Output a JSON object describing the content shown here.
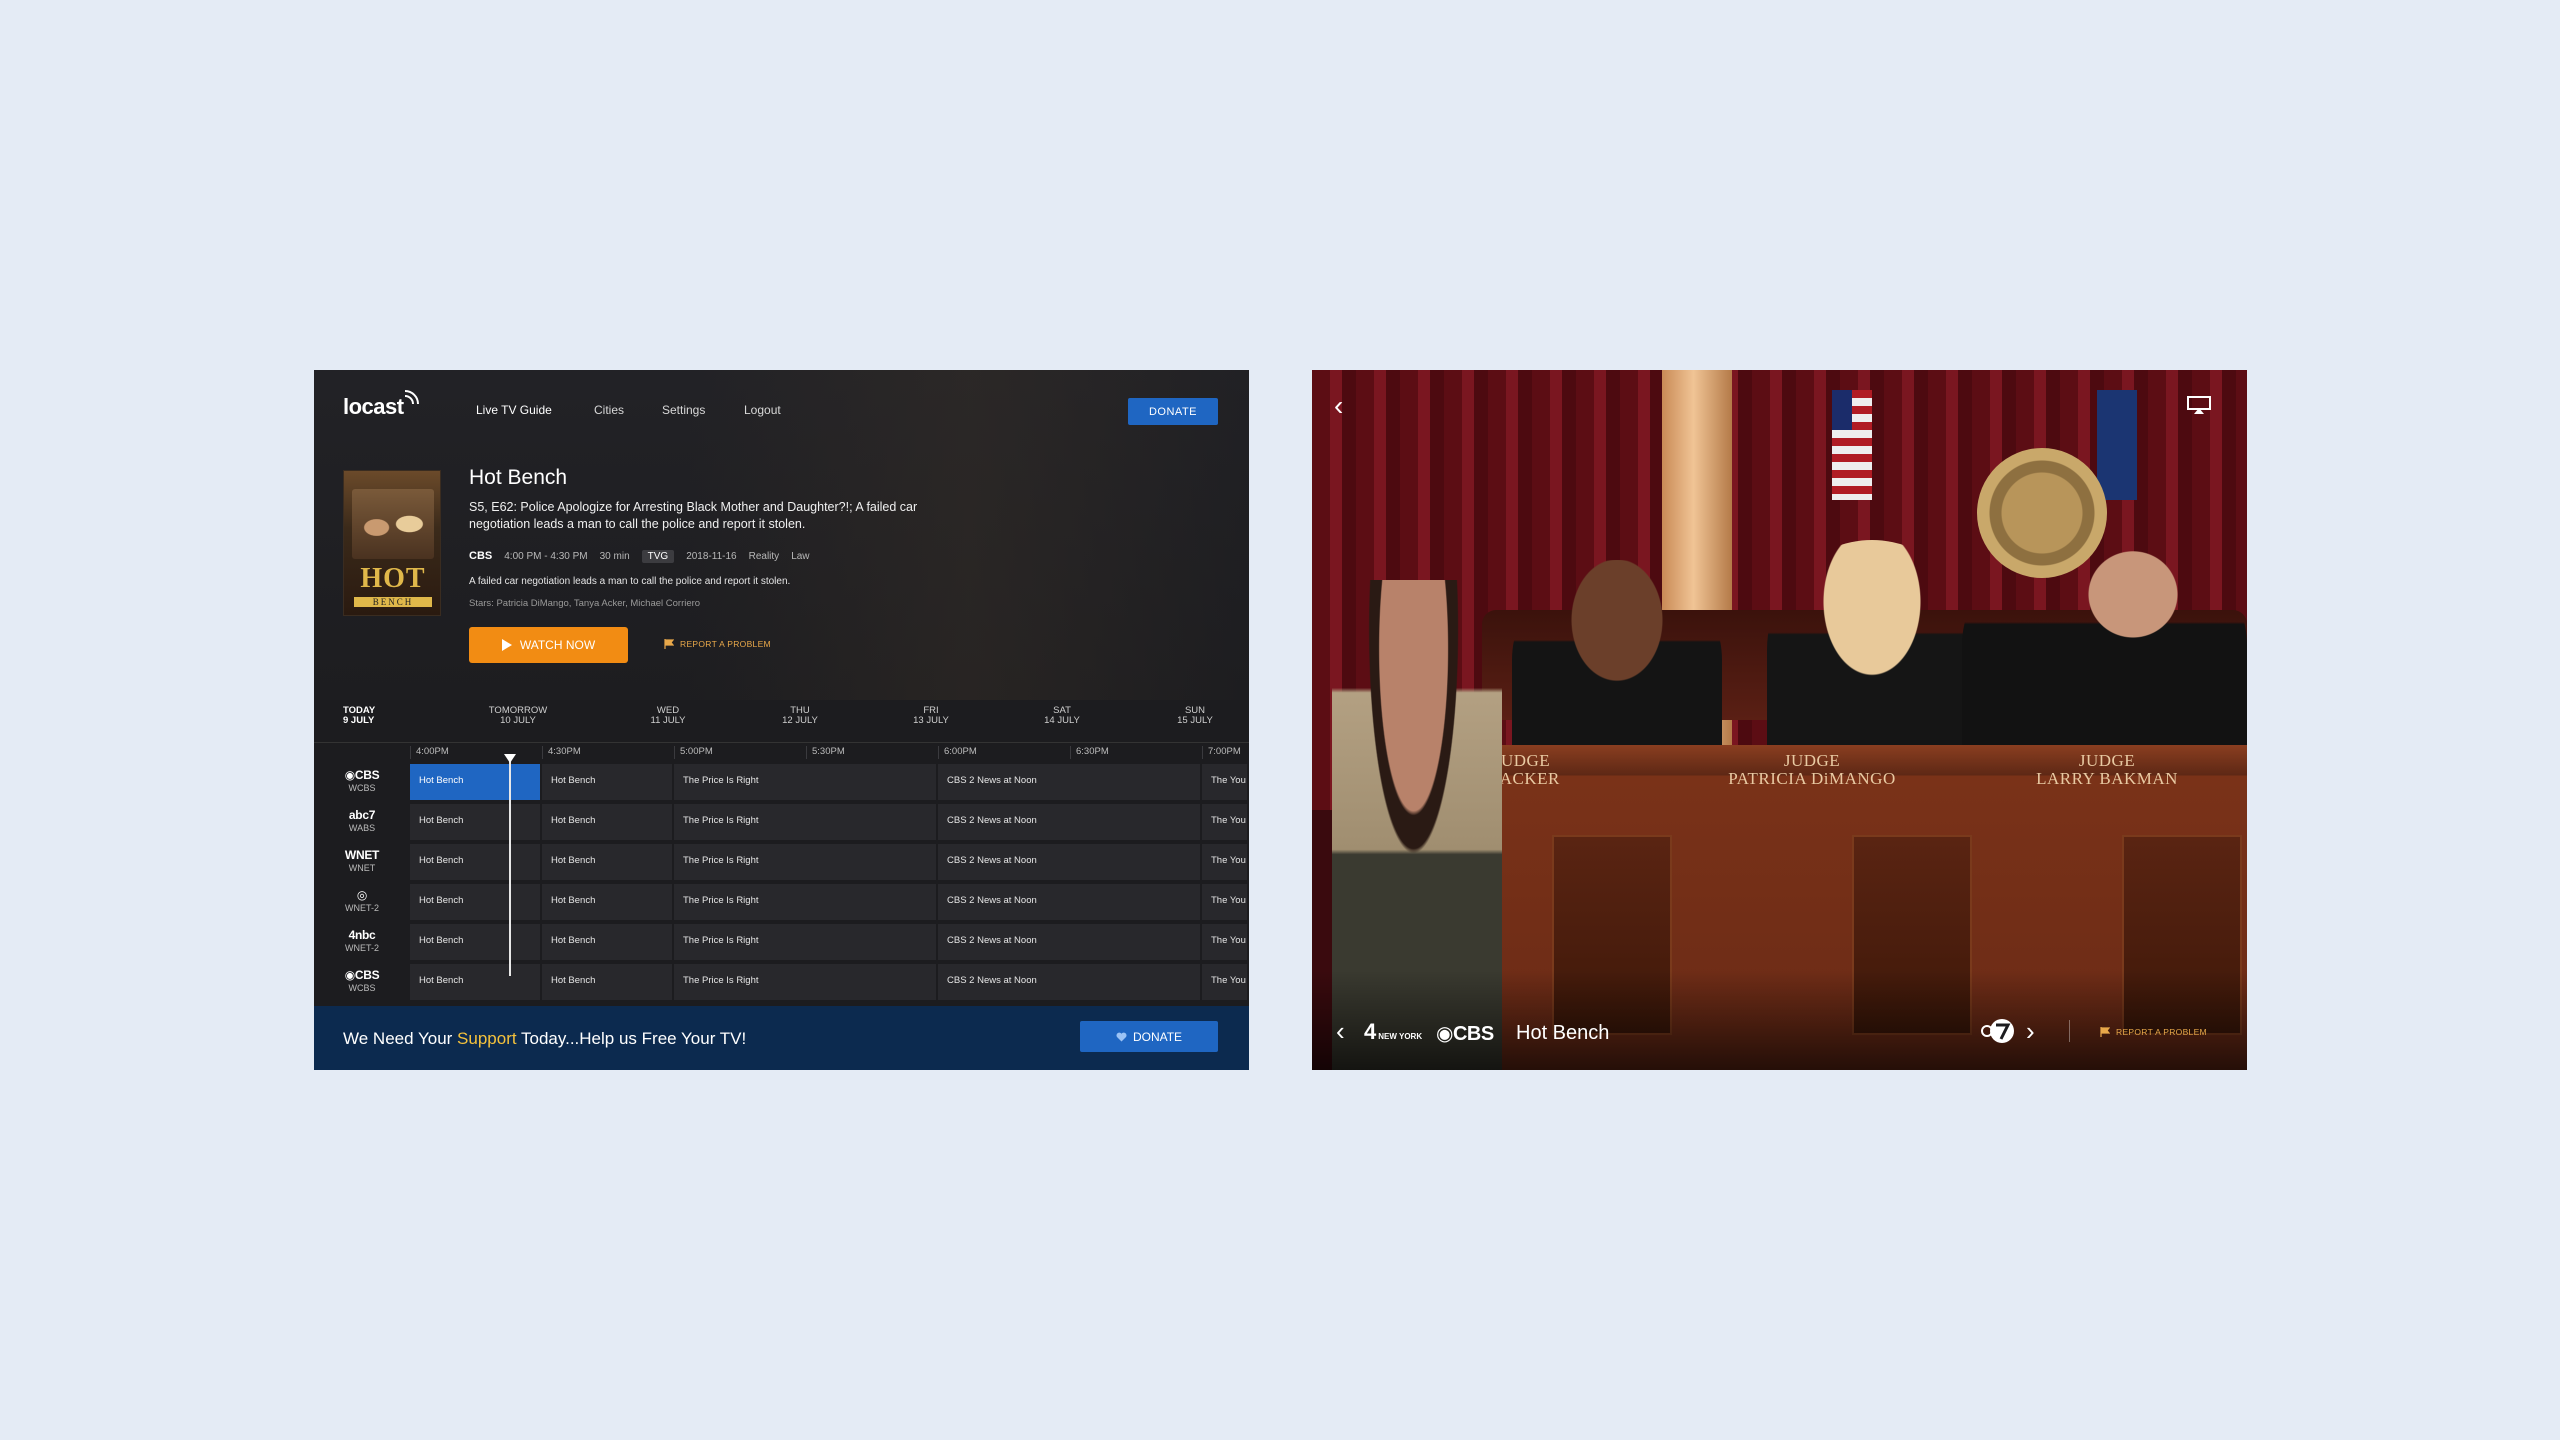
{
  "guide": {
    "logo": "locast",
    "nav": [
      "Live TV Guide",
      "Cities",
      "Settings",
      "Logout"
    ],
    "donate_top": "DONATE",
    "show": {
      "title": "Hot Bench",
      "poster_title": "HOT",
      "poster_subtitle": "BENCH",
      "episode": "S5, E62: Police Apologize for Arresting Black Mother and Daughter?!; A failed car negotiation leads a man to call the police and report it stolen.",
      "network": "CBS",
      "time": "4:00 PM - 4:30 PM",
      "duration": "30 min",
      "rating": "TVG",
      "date": "2018-11-16",
      "genre1": "Reality",
      "genre2": "Law",
      "description": "A failed car negotiation leads a man to call the police and report it stolen.",
      "stars": "Stars: Patricia DiMango, Tanya Acker, Michael Corriero",
      "watch_label": "WATCH NOW",
      "report_label": "REPORT A PROBLEM"
    },
    "days": [
      {
        "top": "TODAY",
        "bottom": "9 JULY"
      },
      {
        "top": "TOMORROW",
        "bottom": "10 JULY"
      },
      {
        "top": "WED",
        "bottom": "11 JULY"
      },
      {
        "top": "THU",
        "bottom": "12 JULY"
      },
      {
        "top": "FRI",
        "bottom": "13 JULY"
      },
      {
        "top": "SAT",
        "bottom": "14 JULY"
      },
      {
        "top": "SUN",
        "bottom": "15 JULY"
      }
    ],
    "times": [
      "4:00PM",
      "4:30PM",
      "5:00PM",
      "5:30PM",
      "6:00PM",
      "6:30PM",
      "7:00PM"
    ],
    "channels": [
      {
        "logo": "◉CBS",
        "call": "WCBS"
      },
      {
        "logo": "abc7",
        "call": "WABS"
      },
      {
        "logo": "WNET",
        "call": "WNET"
      },
      {
        "logo": "◎",
        "call": "WNET-2"
      },
      {
        "logo": "4nbc",
        "call": "WNET-2"
      },
      {
        "logo": "◉CBS",
        "call": "WCBS"
      }
    ],
    "programs": [
      "Hot Bench",
      "Hot Bench",
      "The Price Is Right",
      "CBS 2 News at Noon",
      "The You"
    ],
    "banner": {
      "pre": "We Need Your ",
      "highlight": "Support",
      "post": " Today...Help us Free Your TV!",
      "donate": "DONATE"
    }
  },
  "player": {
    "title": "Hot Bench",
    "channel_left": "4",
    "channel_left_sub": "NEW YORK",
    "channel_current": "◉CBS",
    "report_label": "REPORT A PROBLEM",
    "nameplates": [
      "JUDGE\nA ACKER",
      "JUDGE\nPATRICIA DiMANGO",
      "JUDGE\nLARRY BAKMAN"
    ]
  },
  "colors": {
    "accent_blue": "#1f66c2",
    "watch_orange": "#f28c13",
    "banner_navy": "#0c2a4f",
    "report_orange": "#e8a84a"
  }
}
